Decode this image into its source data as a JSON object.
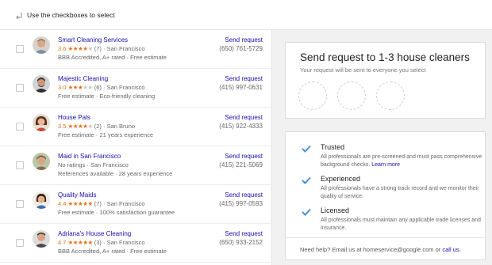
{
  "hint": {
    "text": "Use the checkboxes to select"
  },
  "providers": [
    {
      "name": "Smart Cleaning Services",
      "score": "3.6",
      "stars_filled": 3,
      "stars_half": 1,
      "reviews": "(7)",
      "location": "· San Francisco",
      "tags": "BBB Accredited, A+ rated · Free estimate",
      "send": "Send request",
      "phone": "(650) 761-5729"
    },
    {
      "name": "Majestic Cleaning",
      "score": "3.0",
      "stars_filled": 3,
      "stars_half": 0,
      "reviews": "(6)",
      "location": "· San Francisco",
      "tags": "Free estimate · Eco-friendly cleaning",
      "send": "Send request",
      "phone": "(415) 997-0631"
    },
    {
      "name": "House Pals",
      "score": "3.5",
      "stars_filled": 3,
      "stars_half": 1,
      "reviews": "(2)",
      "location": "· San Bruno",
      "tags": "Free estimate · 21 years experience",
      "send": "Send request",
      "phone": "(415) 922-4333"
    },
    {
      "name": "Maid in San Francisco",
      "no_ratings": "No ratings · San Francisco",
      "tags": "References available · 28 years experience",
      "send": "Send request",
      "phone": "(415) 221-5069"
    },
    {
      "name": "Quality Maids",
      "score": "4.4",
      "stars_filled": 4,
      "stars_half": 1,
      "reviews": "(7)",
      "location": "· San Francisco",
      "tags": "Free estimate · 100% satisfaction guarantee",
      "send": "Send request",
      "phone": "(415) 997-0593"
    },
    {
      "name": "Adriana's House Cleaning",
      "score": "4.7",
      "stars_filled": 4,
      "stars_half": 1,
      "reviews": "(3)",
      "location": "· San Francisco",
      "tags": "BBB Accredited, A+ rated · Free estimate",
      "send": "Send request",
      "phone": "(650) 933-2152"
    }
  ],
  "request": {
    "title": "Send request to 1-3 house cleaners",
    "subtitle": "Your request will be sent to everyone you select"
  },
  "features": [
    {
      "title": "Trusted",
      "desc": "All professionals are pre-screened and must pass comprehensive background checks.",
      "link": "Learn more"
    },
    {
      "title": "Experienced",
      "desc": "All professionals have a strong track record and we monitor their quality of service."
    },
    {
      "title": "Licensed",
      "desc": "All professionals must maintain any applicable trade licenses and insurance."
    }
  ],
  "help": {
    "prefix": "Need help? Email us at homeservice@google.com or",
    "link": "call us",
    "suffix": "."
  },
  "colors": {
    "link": "#1a0dab",
    "star": "#e7711b",
    "check": "#4a8fd8"
  }
}
